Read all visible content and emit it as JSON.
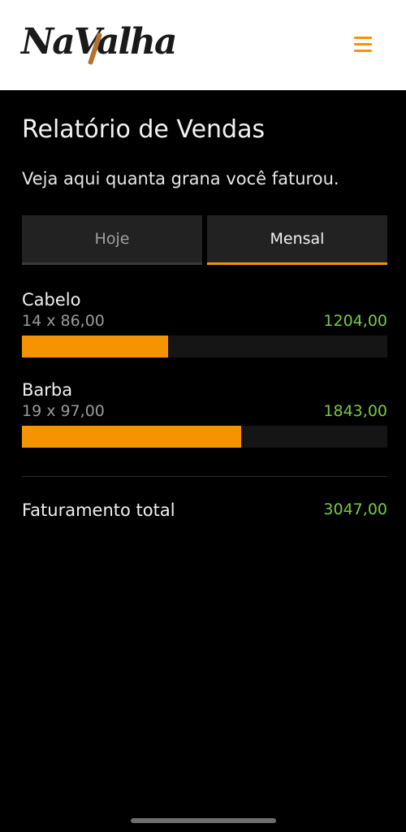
{
  "header": {
    "logo_text": "NaValha",
    "menu_icon": "hamburger-icon",
    "accent_color": "#f59400"
  },
  "page": {
    "title": "Relatório de Vendas",
    "subtitle": "Veja aqui quanta grana você faturou."
  },
  "tabs": [
    {
      "label": "Hoje",
      "active": false
    },
    {
      "label": "Mensal",
      "active": true
    }
  ],
  "items": [
    {
      "name": "Cabelo",
      "detail": "14 x 86,00",
      "value": "1204,00",
      "fill_fraction": 0.4
    },
    {
      "name": "Barba",
      "detail": "19 x 97,00",
      "value": "1843,00",
      "fill_fraction": 0.6
    }
  ],
  "total": {
    "label": "Faturamento total",
    "value": "3047,00"
  },
  "colors": {
    "bar": "#f59400",
    "value_green": "#7ac943"
  }
}
